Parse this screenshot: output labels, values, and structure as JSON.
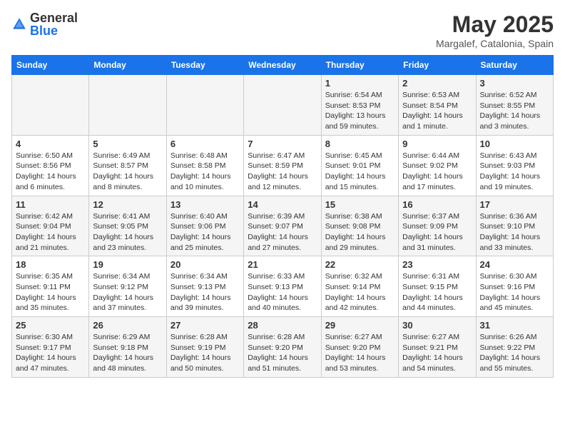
{
  "header": {
    "logo_general": "General",
    "logo_blue": "Blue",
    "title": "May 2025",
    "subtitle": "Margalef, Catalonia, Spain"
  },
  "calendar": {
    "days_of_week": [
      "Sunday",
      "Monday",
      "Tuesday",
      "Wednesday",
      "Thursday",
      "Friday",
      "Saturday"
    ],
    "weeks": [
      [
        {
          "day": "",
          "info": ""
        },
        {
          "day": "",
          "info": ""
        },
        {
          "day": "",
          "info": ""
        },
        {
          "day": "",
          "info": ""
        },
        {
          "day": "1",
          "info": "Sunrise: 6:54 AM\nSunset: 8:53 PM\nDaylight: 13 hours and 59 minutes."
        },
        {
          "day": "2",
          "info": "Sunrise: 6:53 AM\nSunset: 8:54 PM\nDaylight: 14 hours and 1 minute."
        },
        {
          "day": "3",
          "info": "Sunrise: 6:52 AM\nSunset: 8:55 PM\nDaylight: 14 hours and 3 minutes."
        }
      ],
      [
        {
          "day": "4",
          "info": "Sunrise: 6:50 AM\nSunset: 8:56 PM\nDaylight: 14 hours and 6 minutes."
        },
        {
          "day": "5",
          "info": "Sunrise: 6:49 AM\nSunset: 8:57 PM\nDaylight: 14 hours and 8 minutes."
        },
        {
          "day": "6",
          "info": "Sunrise: 6:48 AM\nSunset: 8:58 PM\nDaylight: 14 hours and 10 minutes."
        },
        {
          "day": "7",
          "info": "Sunrise: 6:47 AM\nSunset: 8:59 PM\nDaylight: 14 hours and 12 minutes."
        },
        {
          "day": "8",
          "info": "Sunrise: 6:45 AM\nSunset: 9:01 PM\nDaylight: 14 hours and 15 minutes."
        },
        {
          "day": "9",
          "info": "Sunrise: 6:44 AM\nSunset: 9:02 PM\nDaylight: 14 hours and 17 minutes."
        },
        {
          "day": "10",
          "info": "Sunrise: 6:43 AM\nSunset: 9:03 PM\nDaylight: 14 hours and 19 minutes."
        }
      ],
      [
        {
          "day": "11",
          "info": "Sunrise: 6:42 AM\nSunset: 9:04 PM\nDaylight: 14 hours and 21 minutes."
        },
        {
          "day": "12",
          "info": "Sunrise: 6:41 AM\nSunset: 9:05 PM\nDaylight: 14 hours and 23 minutes."
        },
        {
          "day": "13",
          "info": "Sunrise: 6:40 AM\nSunset: 9:06 PM\nDaylight: 14 hours and 25 minutes."
        },
        {
          "day": "14",
          "info": "Sunrise: 6:39 AM\nSunset: 9:07 PM\nDaylight: 14 hours and 27 minutes."
        },
        {
          "day": "15",
          "info": "Sunrise: 6:38 AM\nSunset: 9:08 PM\nDaylight: 14 hours and 29 minutes."
        },
        {
          "day": "16",
          "info": "Sunrise: 6:37 AM\nSunset: 9:09 PM\nDaylight: 14 hours and 31 minutes."
        },
        {
          "day": "17",
          "info": "Sunrise: 6:36 AM\nSunset: 9:10 PM\nDaylight: 14 hours and 33 minutes."
        }
      ],
      [
        {
          "day": "18",
          "info": "Sunrise: 6:35 AM\nSunset: 9:11 PM\nDaylight: 14 hours and 35 minutes."
        },
        {
          "day": "19",
          "info": "Sunrise: 6:34 AM\nSunset: 9:12 PM\nDaylight: 14 hours and 37 minutes."
        },
        {
          "day": "20",
          "info": "Sunrise: 6:34 AM\nSunset: 9:13 PM\nDaylight: 14 hours and 39 minutes."
        },
        {
          "day": "21",
          "info": "Sunrise: 6:33 AM\nSunset: 9:13 PM\nDaylight: 14 hours and 40 minutes."
        },
        {
          "day": "22",
          "info": "Sunrise: 6:32 AM\nSunset: 9:14 PM\nDaylight: 14 hours and 42 minutes."
        },
        {
          "day": "23",
          "info": "Sunrise: 6:31 AM\nSunset: 9:15 PM\nDaylight: 14 hours and 44 minutes."
        },
        {
          "day": "24",
          "info": "Sunrise: 6:30 AM\nSunset: 9:16 PM\nDaylight: 14 hours and 45 minutes."
        }
      ],
      [
        {
          "day": "25",
          "info": "Sunrise: 6:30 AM\nSunset: 9:17 PM\nDaylight: 14 hours and 47 minutes."
        },
        {
          "day": "26",
          "info": "Sunrise: 6:29 AM\nSunset: 9:18 PM\nDaylight: 14 hours and 48 minutes."
        },
        {
          "day": "27",
          "info": "Sunrise: 6:28 AM\nSunset: 9:19 PM\nDaylight: 14 hours and 50 minutes."
        },
        {
          "day": "28",
          "info": "Sunrise: 6:28 AM\nSunset: 9:20 PM\nDaylight: 14 hours and 51 minutes."
        },
        {
          "day": "29",
          "info": "Sunrise: 6:27 AM\nSunset: 9:20 PM\nDaylight: 14 hours and 53 minutes."
        },
        {
          "day": "30",
          "info": "Sunrise: 6:27 AM\nSunset: 9:21 PM\nDaylight: 14 hours and 54 minutes."
        },
        {
          "day": "31",
          "info": "Sunrise: 6:26 AM\nSunset: 9:22 PM\nDaylight: 14 hours and 55 minutes."
        }
      ]
    ]
  }
}
